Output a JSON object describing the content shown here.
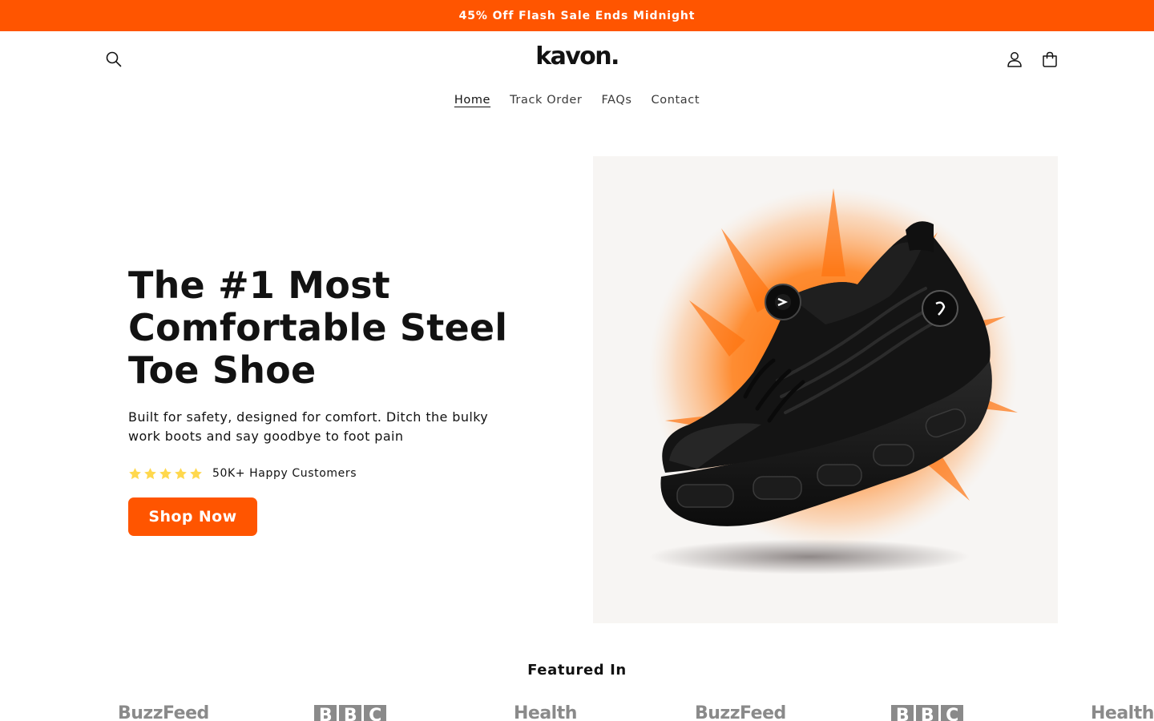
{
  "announcement": {
    "text": "45% Off Flash Sale Ends Midnight",
    "bg_color": "#ff5500"
  },
  "header": {
    "logo": "kavon.",
    "icons": {
      "search": "search-icon",
      "account": "user-icon",
      "cart": "bag-icon"
    },
    "nav": [
      {
        "label": "Home",
        "active": true
      },
      {
        "label": "Track Order",
        "active": false
      },
      {
        "label": "FAQs",
        "active": false
      },
      {
        "label": "Contact",
        "active": false
      }
    ]
  },
  "hero": {
    "title_lines": [
      "The #1 Most",
      "Comfortable Steel",
      "Toe Shoe"
    ],
    "subtitle": "Built for safety, designed for comfort. Ditch the bulky work boots and say goodbye to foot pain",
    "rating": {
      "stars": 5,
      "text": "50K+ Happy Customers",
      "star_color": "#ffd84d"
    },
    "cta_label": "Shop Now",
    "accent_color": "#ff5500",
    "image": "black steel toe sneaker with orange powder burst"
  },
  "featured": {
    "title": "Featured In",
    "logos": [
      "BuzzFeed",
      "BBC",
      "Health",
      "BuzzFeed",
      "BBC",
      "Health"
    ]
  }
}
